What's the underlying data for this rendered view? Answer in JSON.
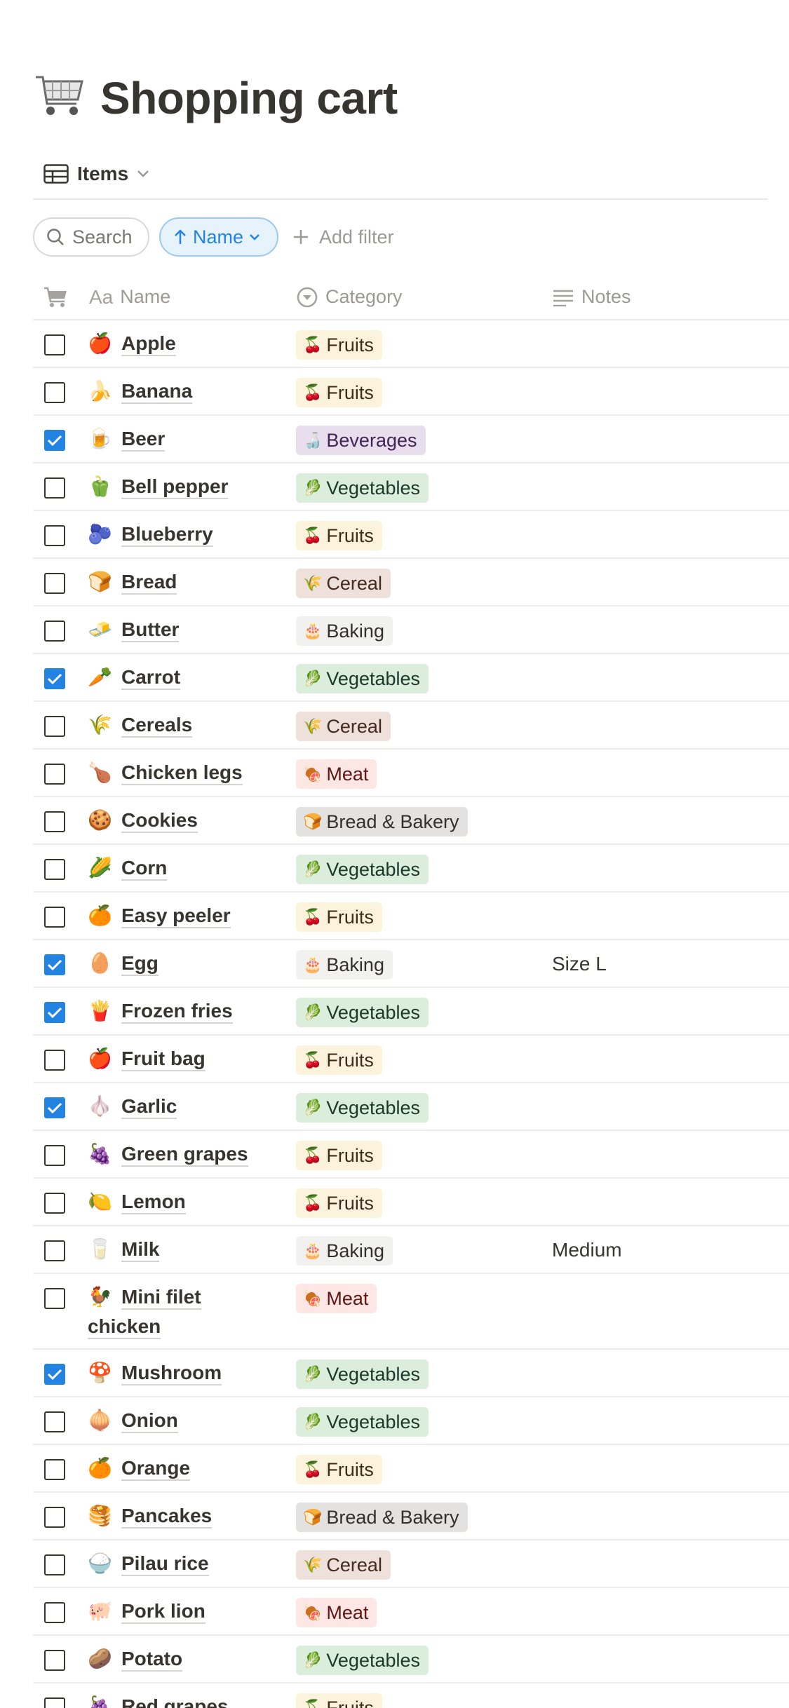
{
  "page": {
    "title": "Shopping cart",
    "title_icon": "shopping-cart-icon"
  },
  "view": {
    "label": "Items",
    "icon": "table-icon"
  },
  "controls": {
    "search_label": "Search",
    "sort_label": "Name",
    "add_filter_label": "Add filter"
  },
  "columns": {
    "check": "cart-icon",
    "name": "Name",
    "category": "Category",
    "notes": "Notes"
  },
  "colors": {
    "accent": "#2383e2",
    "text": "#37352f",
    "muted": "#9b9a97"
  },
  "items": [
    {
      "checked": false,
      "emoji": "🍎",
      "name": "Apple",
      "category": "Fruits",
      "cat_emoji": "🍒",
      "cat_class": "t-fruits",
      "notes": ""
    },
    {
      "checked": false,
      "emoji": "🍌",
      "name": "Banana",
      "category": "Fruits",
      "cat_emoji": "🍒",
      "cat_class": "t-fruits",
      "notes": ""
    },
    {
      "checked": true,
      "emoji": "🍺",
      "name": "Beer",
      "category": "Beverages",
      "cat_emoji": "🍶",
      "cat_class": "t-beverages",
      "notes": ""
    },
    {
      "checked": false,
      "emoji": "🫑",
      "name": "Bell pepper",
      "category": "Vegetables",
      "cat_emoji": "🥬",
      "cat_class": "t-vegetables",
      "notes": ""
    },
    {
      "checked": false,
      "emoji": "🫐",
      "name": "Blueberry",
      "category": "Fruits",
      "cat_emoji": "🍒",
      "cat_class": "t-fruits",
      "notes": ""
    },
    {
      "checked": false,
      "emoji": "🍞",
      "name": "Bread",
      "category": "Cereal",
      "cat_emoji": "🌾",
      "cat_class": "t-cereal",
      "notes": ""
    },
    {
      "checked": false,
      "emoji": "🧈",
      "name": "Butter",
      "category": "Baking",
      "cat_emoji": "🎂",
      "cat_class": "t-baking",
      "notes": ""
    },
    {
      "checked": true,
      "emoji": "🥕",
      "name": "Carrot",
      "category": "Vegetables",
      "cat_emoji": "🥬",
      "cat_class": "t-vegetables",
      "notes": ""
    },
    {
      "checked": false,
      "emoji": "🌾",
      "name": "Cereals",
      "category": "Cereal",
      "cat_emoji": "🌾",
      "cat_class": "t-cereal",
      "notes": ""
    },
    {
      "checked": false,
      "emoji": "🍗",
      "name": "Chicken legs",
      "category": "Meat",
      "cat_emoji": "🍖",
      "cat_class": "t-meat",
      "notes": ""
    },
    {
      "checked": false,
      "emoji": "🍪",
      "name": "Cookies",
      "category": "Bread & Bakery",
      "cat_emoji": "🍞",
      "cat_class": "t-bakery",
      "notes": ""
    },
    {
      "checked": false,
      "emoji": "🌽",
      "name": "Corn",
      "category": "Vegetables",
      "cat_emoji": "🥬",
      "cat_class": "t-vegetables",
      "notes": ""
    },
    {
      "checked": false,
      "emoji": "🍊",
      "name": "Easy peeler",
      "category": "Fruits",
      "cat_emoji": "🍒",
      "cat_class": "t-fruits",
      "notes": ""
    },
    {
      "checked": true,
      "emoji": "🥚",
      "name": "Egg",
      "category": "Baking",
      "cat_emoji": "🎂",
      "cat_class": "t-baking",
      "notes": "Size L"
    },
    {
      "checked": true,
      "emoji": "🍟",
      "name": "Frozen fries",
      "category": "Vegetables",
      "cat_emoji": "🥬",
      "cat_class": "t-vegetables",
      "notes": ""
    },
    {
      "checked": false,
      "emoji": "🍎",
      "name": "Fruit bag",
      "category": "Fruits",
      "cat_emoji": "🍒",
      "cat_class": "t-fruits",
      "notes": ""
    },
    {
      "checked": true,
      "emoji": "🧄",
      "name": "Garlic",
      "category": "Vegetables",
      "cat_emoji": "🥬",
      "cat_class": "t-vegetables",
      "notes": ""
    },
    {
      "checked": false,
      "emoji": "🍇",
      "name": "Green grapes",
      "category": "Fruits",
      "cat_emoji": "🍒",
      "cat_class": "t-fruits",
      "notes": ""
    },
    {
      "checked": false,
      "emoji": "🍋",
      "name": "Lemon",
      "category": "Fruits",
      "cat_emoji": "🍒",
      "cat_class": "t-fruits",
      "notes": ""
    },
    {
      "checked": false,
      "emoji": "🥛",
      "name": "Milk",
      "category": "Baking",
      "cat_emoji": "🎂",
      "cat_class": "t-baking",
      "notes": "Medium"
    },
    {
      "checked": false,
      "emoji": "🐓",
      "name": "Mini filet chicken",
      "category": "Meat",
      "cat_emoji": "🍖",
      "cat_class": "t-meat",
      "notes": ""
    },
    {
      "checked": true,
      "emoji": "🍄",
      "name": "Mushroom",
      "category": "Vegetables",
      "cat_emoji": "🥬",
      "cat_class": "t-vegetables",
      "notes": ""
    },
    {
      "checked": false,
      "emoji": "🧅",
      "name": "Onion",
      "category": "Vegetables",
      "cat_emoji": "🥬",
      "cat_class": "t-vegetables",
      "notes": ""
    },
    {
      "checked": false,
      "emoji": "🍊",
      "name": "Orange",
      "category": "Fruits",
      "cat_emoji": "🍒",
      "cat_class": "t-fruits",
      "notes": ""
    },
    {
      "checked": false,
      "emoji": "🥞",
      "name": "Pancakes",
      "category": "Bread & Bakery",
      "cat_emoji": "🍞",
      "cat_class": "t-bakery",
      "notes": ""
    },
    {
      "checked": false,
      "emoji": "🍚",
      "name": "Pilau rice",
      "category": "Cereal",
      "cat_emoji": "🌾",
      "cat_class": "t-cereal",
      "notes": ""
    },
    {
      "checked": false,
      "emoji": "🐖",
      "name": "Pork lion",
      "category": "Meat",
      "cat_emoji": "🍖",
      "cat_class": "t-meat",
      "notes": ""
    },
    {
      "checked": false,
      "emoji": "🥔",
      "name": "Potato",
      "category": "Vegetables",
      "cat_emoji": "🥬",
      "cat_class": "t-vegetables",
      "notes": ""
    },
    {
      "checked": false,
      "emoji": "🍇",
      "name": "Red grapes",
      "category": "Fruits",
      "cat_emoji": "🍒",
      "cat_class": "t-fruits",
      "notes": ""
    }
  ]
}
